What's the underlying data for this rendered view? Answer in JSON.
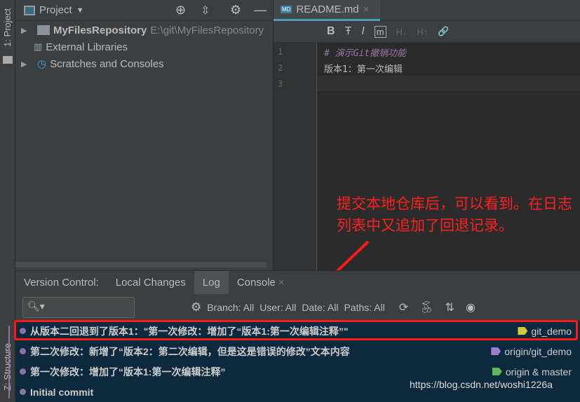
{
  "stripe": {
    "project": "1: Project",
    "structure": "Z: Structure"
  },
  "project": {
    "title": "Project",
    "tree": [
      {
        "name": "MyFilesRepository",
        "path": "E:\\git\\MyFilesRepository"
      },
      {
        "name": "External Libraries"
      },
      {
        "name": "Scratches and Consoles"
      }
    ]
  },
  "editor": {
    "tab": "README.md",
    "toolbar": [
      "B",
      "Ŧ",
      "I",
      "m",
      "H↓",
      "H↑",
      "🔗"
    ],
    "lines": [
      {
        "no": "1",
        "text": "# 演示Git撤销功能"
      },
      {
        "no": "2",
        "text": "版本1：第一次编辑"
      },
      {
        "no": "3",
        "text": ""
      }
    ]
  },
  "annotation": "提交本地仓库后，可以看到。在日志列表中又追加了回退记录。",
  "vc": {
    "label": "Version Control:",
    "tabs": [
      "Local Changes",
      "Log",
      "Console"
    ],
    "filters": [
      "Branch: All",
      "User: All",
      "Date: All",
      "Paths: All"
    ],
    "commits": [
      {
        "msg": "从版本二回退到了版本1：\"第一次修改：增加了“版本1:第一次编辑注释”\"",
        "ref": "git_demo",
        "color": "#d4c93a"
      },
      {
        "msg": "第二次修改：新增了“版本2：第二次编辑，但是这是错误的修改”文本内容",
        "ref": "origin/git_demo",
        "color": "#a07ec8"
      },
      {
        "msg": "第一次修改：增加了“版本1:第一次编辑注释”",
        "ref": "origin & master",
        "color": "#5fb85f"
      },
      {
        "msg": "Initial commit",
        "ref": ""
      }
    ]
  },
  "watermark": "https://blog.csdn.net/woshi1226a"
}
